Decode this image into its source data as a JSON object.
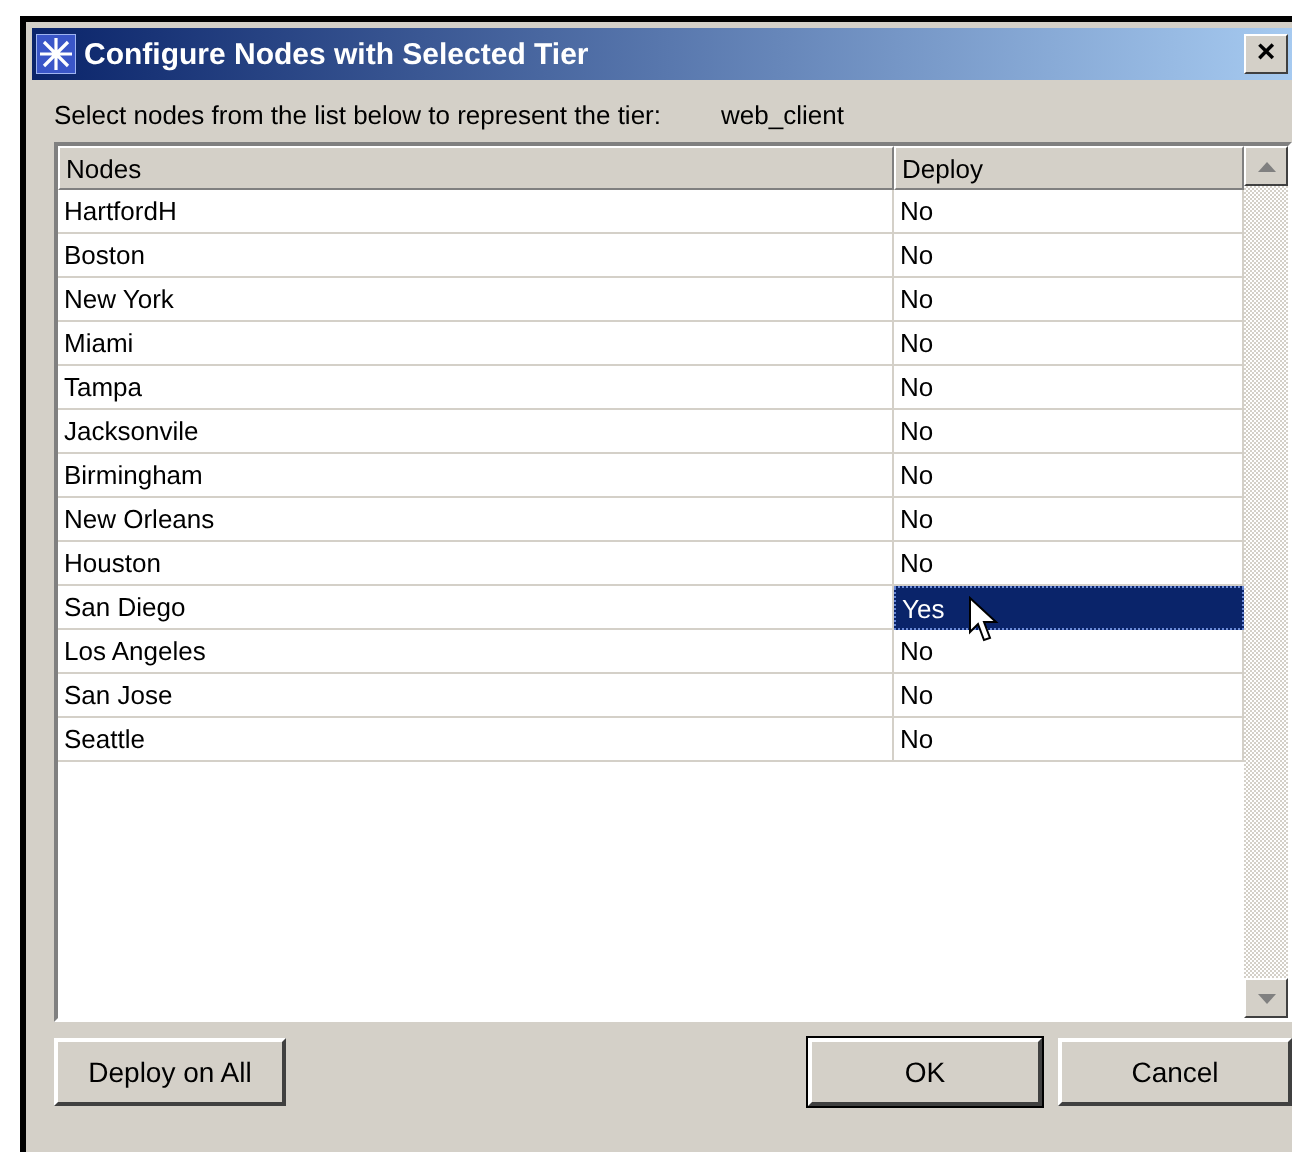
{
  "window": {
    "title": "Configure Nodes with Selected Tier",
    "close": "×"
  },
  "prompt": {
    "label": "Select nodes from the list below to represent the tier:",
    "tier": "web_client"
  },
  "table": {
    "columns": [
      "Nodes",
      "Deploy"
    ],
    "rows": [
      {
        "node": "HartfordH",
        "deploy": "No",
        "selected": false
      },
      {
        "node": "Boston",
        "deploy": "No",
        "selected": false
      },
      {
        "node": "New York",
        "deploy": "No",
        "selected": false
      },
      {
        "node": "Miami",
        "deploy": "No",
        "selected": false
      },
      {
        "node": "Tampa",
        "deploy": "No",
        "selected": false
      },
      {
        "node": "Jacksonvile",
        "deploy": "No",
        "selected": false
      },
      {
        "node": "Birmingham",
        "deploy": "No",
        "selected": false
      },
      {
        "node": "New Orleans",
        "deploy": "No",
        "selected": false
      },
      {
        "node": "Houston",
        "deploy": "No",
        "selected": false
      },
      {
        "node": "San Diego",
        "deploy": "Yes",
        "selected": true
      },
      {
        "node": "Los Angeles",
        "deploy": "No",
        "selected": false
      },
      {
        "node": "San Jose",
        "deploy": "No",
        "selected": false
      },
      {
        "node": "Seattle",
        "deploy": "No",
        "selected": false
      }
    ]
  },
  "buttons": [
    {
      "label": "Deploy on All",
      "kind": "left",
      "default": false
    },
    {
      "label": "OK",
      "kind": "right",
      "default": true
    },
    {
      "label": "Cancel",
      "kind": "right",
      "default": false
    }
  ]
}
